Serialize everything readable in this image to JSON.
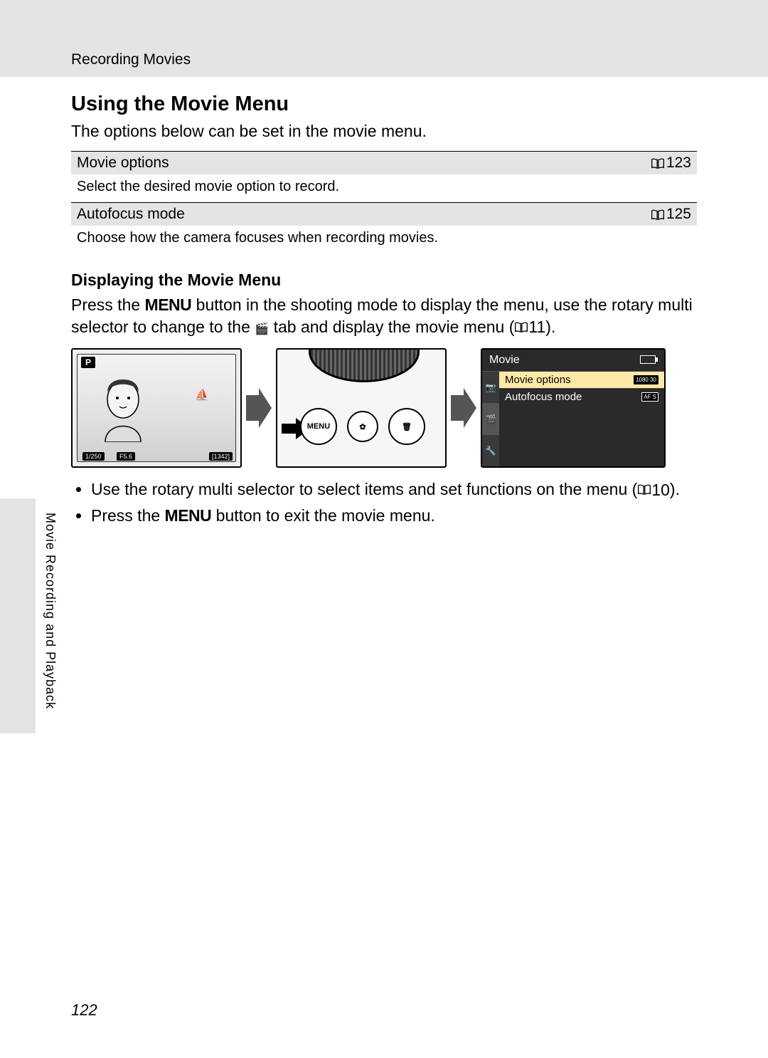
{
  "header": {
    "breadcrumb": "Recording Movies"
  },
  "section": {
    "title": "Using the Movie Menu",
    "intro": "The options below can be set in the movie menu."
  },
  "options": [
    {
      "name": "Movie options",
      "page": "123",
      "desc": "Select the desired movie option to record."
    },
    {
      "name": "Autofocus mode",
      "page": "125",
      "desc": "Choose how the camera focuses when recording movies."
    }
  ],
  "subsection": {
    "title": "Displaying the Movie Menu",
    "para_a": "Press the ",
    "menu_label": "MENU",
    "para_b": " button in the shooting mode to display the menu, use the rotary multi selector to change to the ",
    "para_c": " tab and display the movie menu (",
    "ref1": "11",
    "para_d": ")."
  },
  "cam_screen": {
    "mode": "P",
    "shutter": "1/250",
    "fstop": "F5.6",
    "shots": "[1342]"
  },
  "buttons": {
    "menu": "MENU"
  },
  "movie_menu": {
    "title": "Movie",
    "items": [
      {
        "label": "Movie options",
        "badge": "1080 30"
      },
      {
        "label": "Autofocus mode",
        "badge": "AF S"
      }
    ]
  },
  "bullets": {
    "b1a": "Use the rotary multi selector to select items and set functions on the menu (",
    "b1ref": "10",
    "b1b": ").",
    "b2a": "Press the ",
    "b2b": " button to exit the movie menu."
  },
  "side_label": "Movie Recording and Playback",
  "page_number": "122"
}
